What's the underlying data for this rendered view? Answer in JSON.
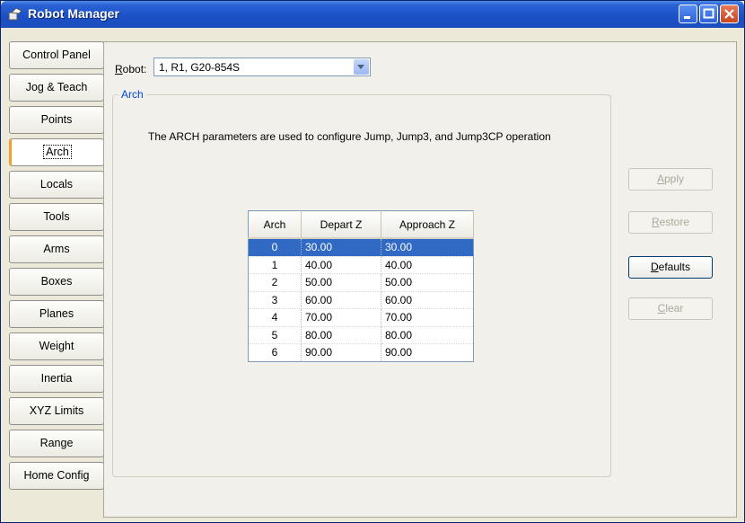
{
  "window": {
    "title": "Robot Manager"
  },
  "tabs": [
    {
      "label": "Control Panel"
    },
    {
      "label": "Jog & Teach"
    },
    {
      "label": "Points"
    },
    {
      "label": "Arch"
    },
    {
      "label": "Locals"
    },
    {
      "label": "Tools"
    },
    {
      "label": "Arms"
    },
    {
      "label": "Boxes"
    },
    {
      "label": "Planes"
    },
    {
      "label": "Weight"
    },
    {
      "label": "Inertia"
    },
    {
      "label": "XYZ Limits"
    },
    {
      "label": "Range"
    },
    {
      "label": "Home Config"
    }
  ],
  "active_tab": "Arch",
  "robot": {
    "label_prefix": "R",
    "label_rest": "obot:",
    "value": "1, R1, G20-854S"
  },
  "group": {
    "title": "Arch",
    "description": "The ARCH parameters are used to configure Jump, Jump3, and Jump3CP operation"
  },
  "buttons": {
    "apply": {
      "key": "A",
      "rest": "pply",
      "enabled": false
    },
    "restore": {
      "key": "R",
      "rest": "estore",
      "enabled": false
    },
    "defaults": {
      "key": "D",
      "rest": "efaults",
      "enabled": true
    },
    "clear": {
      "key": "C",
      "rest": "lear",
      "enabled": false
    }
  },
  "table": {
    "columns": [
      "Arch",
      "Depart Z",
      "Approach Z"
    ],
    "rows": [
      [
        "0",
        "30.00",
        "30.00"
      ],
      [
        "1",
        "40.00",
        "40.00"
      ],
      [
        "2",
        "50.00",
        "50.00"
      ],
      [
        "3",
        "60.00",
        "60.00"
      ],
      [
        "4",
        "70.00",
        "70.00"
      ],
      [
        "5",
        "80.00",
        "80.00"
      ],
      [
        "6",
        "90.00",
        "90.00"
      ]
    ],
    "selected_row": 0
  },
  "colors": {
    "titlebar": "#1d4fbf",
    "selection": "#316ac5",
    "accent_tab": "#f0a030"
  }
}
